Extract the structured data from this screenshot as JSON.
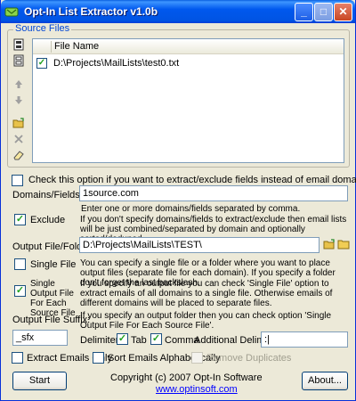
{
  "window": {
    "title": "Opt-In List Extractor v1.0b"
  },
  "source_files": {
    "group_label": "Source Files",
    "column_header": "File Name",
    "files": [
      {
        "checked": true,
        "path": "D:\\Projects\\MailLists\\test0.txt"
      }
    ]
  },
  "options": {
    "extract_fields_label": "Check this option if you want to extract/exclude fields instead of email domains.",
    "domains_label": "Domains/Fields:",
    "domains_value": "1source.com",
    "domains_hint": "Enter one or more domains/fields separated by comma.",
    "exclude_label": "Exclude",
    "exclude_desc": "If you don't specify domains/fields to extract/exclude then email lists will be just combined/separated by domain and optionally sorted/deduped.",
    "output_label": "Output File/Folder:",
    "output_value": "D:\\Projects\\MailLists\\TEST\\",
    "single_file_label": "Single File",
    "single_file_desc": "You can specify a single file or a folder where you want to place output files (separate file for each domain). If you specify a folder don't forget the last backslash.",
    "single_output_label": "Single Output File For Each Source File",
    "single_output_desc1": "If you specify an output file you can check 'Single File' option to extract emails of all domains to a single file. Otherwise emails of different domains will be placed to separate files.",
    "single_output_desc2": "If you specify an output folder then you can check option 'Single Output File For Each Source File'.",
    "suffix_label": "Output File Suffix:",
    "suffix_value": "_sfx",
    "delimiters_label": "Delimiters:",
    "tab_label": "Tab",
    "comma_label": "Comma",
    "additional_label": "Additional Delimiters:",
    "additional_value": ":|",
    "extract_only_label": "Extract Emails Only",
    "sort_label": "Sort Emails Alphabetically",
    "remove_dup_label": "Remove Duplicates"
  },
  "footer": {
    "start_label": "Start",
    "copyright": "Copyright (c) 2007 Opt-In Software",
    "website": "www.optinsoft.com",
    "about_label": "About..."
  },
  "state": {
    "extract_fields": false,
    "exclude": true,
    "single_file": false,
    "single_output": true,
    "tab": true,
    "comma": true,
    "extract_only": false,
    "sort": false,
    "remove_dup": false
  }
}
